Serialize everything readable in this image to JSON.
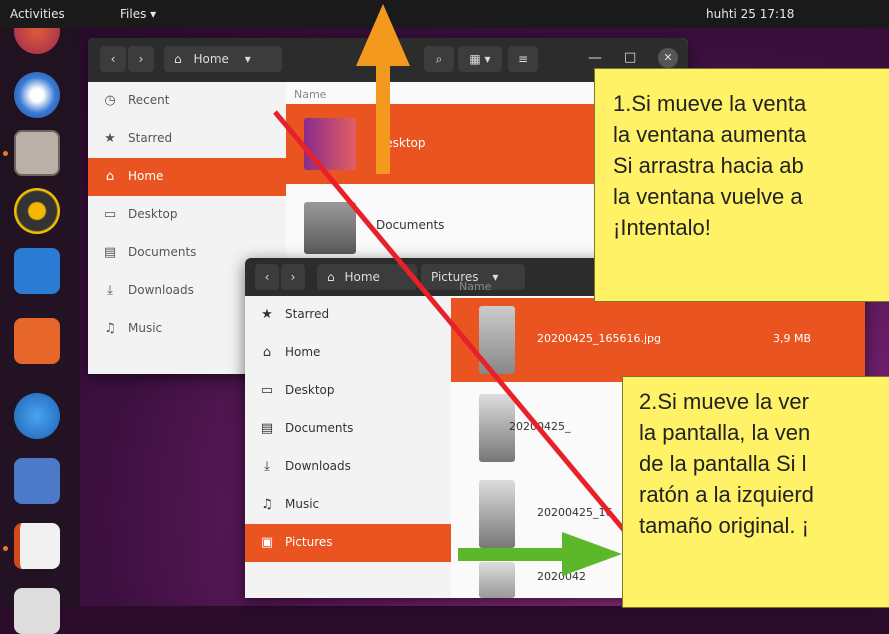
{
  "topbar": {
    "activities": "Activities",
    "app_menu": "Files ▾",
    "clock": "huhti 25 17:18"
  },
  "window_back": {
    "path": "Home",
    "column_name": "Name",
    "sidebar": [
      {
        "label": "Recent",
        "icon": "clock-icon"
      },
      {
        "label": "Starred",
        "icon": "star-icon"
      },
      {
        "label": "Home",
        "icon": "home-icon",
        "selected": true
      },
      {
        "label": "Desktop",
        "icon": "desktop-icon"
      },
      {
        "label": "Documents",
        "icon": "documents-icon"
      },
      {
        "label": "Downloads",
        "icon": "downloads-icon"
      },
      {
        "label": "Music",
        "icon": "music-icon"
      }
    ],
    "files": [
      {
        "name": "Desktop",
        "selected": true
      },
      {
        "name": "Documents"
      }
    ]
  },
  "window_front": {
    "path_home": "Home",
    "path_current": "Pictures",
    "column_name": "Name",
    "sidebar": [
      {
        "label": "Starred",
        "icon": "star-icon"
      },
      {
        "label": "Home",
        "icon": "home-icon"
      },
      {
        "label": "Desktop",
        "icon": "desktop-icon"
      },
      {
        "label": "Documents",
        "icon": "documents-icon"
      },
      {
        "label": "Downloads",
        "icon": "downloads-icon"
      },
      {
        "label": "Music",
        "icon": "music-icon"
      },
      {
        "label": "Pictures",
        "icon": "pictures-icon",
        "selected": true
      }
    ],
    "files": [
      {
        "name": "20200425_165616.jpg",
        "size": "3,9 MB",
        "selected": true
      },
      {
        "name": "20200425_",
        "size": ""
      },
      {
        "name": "20200425_16",
        "size": ""
      },
      {
        "name": "2020042",
        "size": ""
      }
    ]
  },
  "callouts": {
    "one": [
      "1.Si mueve la venta",
      "la ventana aumenta",
      "Si arrastra hacia ab",
      "la ventana vuelve a",
      "¡Intentalo!"
    ],
    "two": [
      "2.Si mueve la ver",
      "la pantalla, la ven",
      "de la pantalla Si l",
      "ratón a la izquierd",
      "tamaño original. ¡"
    ]
  },
  "colors": {
    "accent": "#e95420",
    "arrow_up": "#f39a1e",
    "arrow_right": "#5cb82a",
    "diagonal_line": "#e8202a",
    "callout_bg": "#fff266"
  }
}
